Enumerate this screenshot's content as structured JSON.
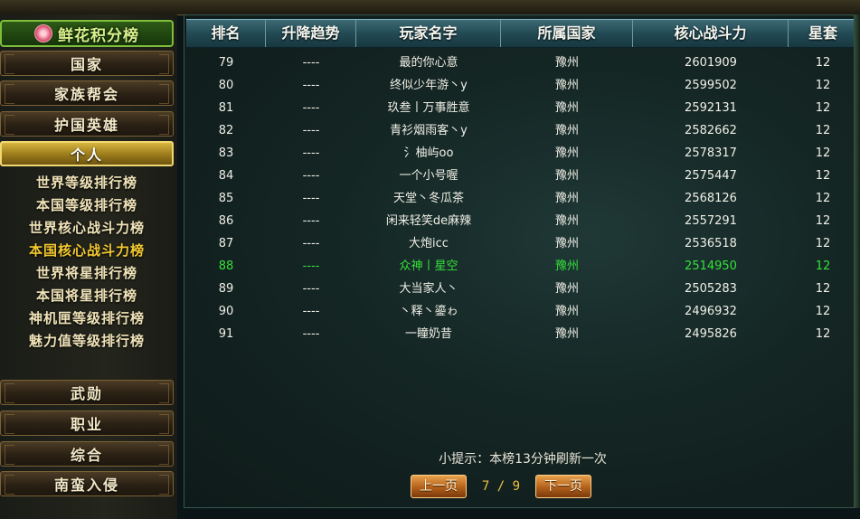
{
  "sidebar": {
    "title": "鲜花积分榜",
    "categories_top": [
      "国家",
      "家族帮会",
      "护国英雄"
    ],
    "active_category": "个人",
    "sub_items": [
      {
        "label": "世界等级排行榜",
        "active": false
      },
      {
        "label": "本国等级排行榜",
        "active": false
      },
      {
        "label": "世界核心战斗力榜",
        "active": false
      },
      {
        "label": "本国核心战斗力榜",
        "active": true
      },
      {
        "label": "世界将星排行榜",
        "active": false
      },
      {
        "label": "本国将星排行榜",
        "active": false
      },
      {
        "label": "神机匣等级排行榜",
        "active": false
      },
      {
        "label": "魅力值等级排行榜",
        "active": false
      }
    ],
    "categories_bottom": [
      "武勋",
      "职业",
      "综合",
      "南蛮入侵"
    ]
  },
  "table": {
    "headers": [
      "排名",
      "升降趋势",
      "玩家名字",
      "所属国家",
      "核心战斗力",
      "星套"
    ],
    "rows": [
      {
        "rank": "79",
        "trend": "----",
        "name": "最的你心意",
        "country": "豫州",
        "power": "2601909",
        "star": "12",
        "highlight": false
      },
      {
        "rank": "80",
        "trend": "----",
        "name": "终似少年游丶y",
        "country": "豫州",
        "power": "2599502",
        "star": "12",
        "highlight": false
      },
      {
        "rank": "81",
        "trend": "----",
        "name": "玖叁丨万事胜意",
        "country": "豫州",
        "power": "2592131",
        "star": "12",
        "highlight": false
      },
      {
        "rank": "82",
        "trend": "----",
        "name": "青衫烟雨客丶y",
        "country": "豫州",
        "power": "2582662",
        "star": "12",
        "highlight": false
      },
      {
        "rank": "83",
        "trend": "----",
        "name": "氵柚屿oo",
        "country": "豫州",
        "power": "2578317",
        "star": "12",
        "highlight": false
      },
      {
        "rank": "84",
        "trend": "----",
        "name": "一个小号喔",
        "country": "豫州",
        "power": "2575447",
        "star": "12",
        "highlight": false
      },
      {
        "rank": "85",
        "trend": "----",
        "name": "天堂丶冬瓜茶",
        "country": "豫州",
        "power": "2568126",
        "star": "12",
        "highlight": false
      },
      {
        "rank": "86",
        "trend": "----",
        "name": "闲来轻笑de麻辣",
        "country": "豫州",
        "power": "2557291",
        "star": "12",
        "highlight": false
      },
      {
        "rank": "87",
        "trend": "----",
        "name": "大炮icc",
        "country": "豫州",
        "power": "2536518",
        "star": "12",
        "highlight": false
      },
      {
        "rank": "88",
        "trend": "----",
        "name": "众神丨星空",
        "country": "豫州",
        "power": "2514950",
        "star": "12",
        "highlight": true
      },
      {
        "rank": "89",
        "trend": "----",
        "name": "大当家人丶",
        "country": "豫州",
        "power": "2505283",
        "star": "12",
        "highlight": false
      },
      {
        "rank": "90",
        "trend": "----",
        "name": "丶释丶鎏ゎ",
        "country": "豫州",
        "power": "2496932",
        "star": "12",
        "highlight": false
      },
      {
        "rank": "91",
        "trend": "----",
        "name": "一瞳奶昔",
        "country": "豫州",
        "power": "2495826",
        "star": "12",
        "highlight": false
      }
    ]
  },
  "tip": "小提示：本榜13分钟刷新一次",
  "pager": {
    "prev": "上一页",
    "page": "7 / 9",
    "next": "下一页"
  },
  "colors": {
    "highlight": "#36e03a",
    "active_sub": "#f3c930",
    "accent_gold": "#f0d870"
  }
}
